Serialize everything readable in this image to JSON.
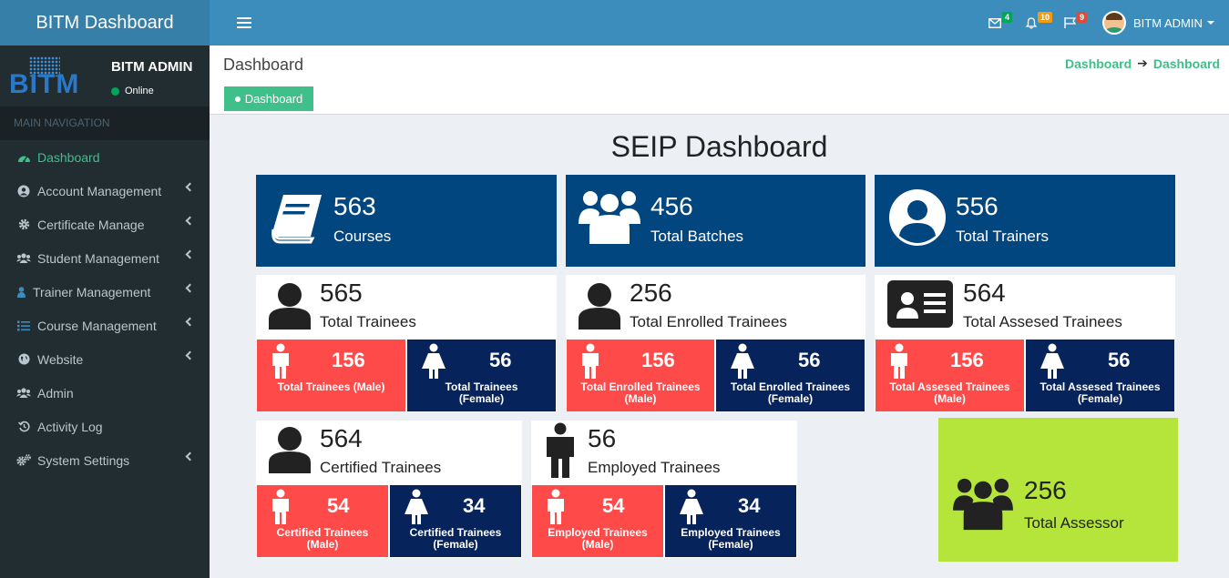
{
  "app": {
    "title": "BITM Dashboard"
  },
  "topbar": {
    "mail_badge": "4",
    "bell_badge": "10",
    "flag_badge": "9",
    "user_name": "BITM ADMIN",
    "colors": {
      "green": "#00a65a",
      "orange": "#f39c12",
      "red": "#dd4b39"
    }
  },
  "sidebar": {
    "logo_text": "BITM",
    "user_name": "BITM ADMIN",
    "status": "Online",
    "nav_header": "MAIN NAVIGATION",
    "items": [
      {
        "label": "Dashboard",
        "icon": "dashboard-icon"
      },
      {
        "label": "Account Management",
        "icon": "user-circle-icon"
      },
      {
        "label": "Certificate Manage",
        "icon": "gear-icon"
      },
      {
        "label": "Student Management",
        "icon": "users-icon"
      },
      {
        "label": "Trainer Management",
        "icon": "user-icon"
      },
      {
        "label": "Course Management",
        "icon": "list-icon"
      },
      {
        "label": "Website",
        "icon": "globe-icon"
      },
      {
        "label": "Admin",
        "icon": "users-icon"
      },
      {
        "label": "Activity Log",
        "icon": "history-icon"
      },
      {
        "label": "System Settings",
        "icon": "gears-icon"
      }
    ]
  },
  "content_header": {
    "title": "Dashboard",
    "breadcrumb_1": "Dashboard",
    "breadcrumb_2": "Dashboard",
    "button_label": "Dashboard"
  },
  "dashboard": {
    "title": "SEIP Dashboard",
    "courses": {
      "value": "563",
      "label": "Courses"
    },
    "batches": {
      "value": "456",
      "label": "Total Batches"
    },
    "trainers": {
      "value": "556",
      "label": "Total Trainers"
    },
    "total_trainees": {
      "value": "565",
      "label": "Total Trainees",
      "male_value": "156",
      "male_label_1": "Total Trainees (Male)",
      "male_label_2": "",
      "female_value": "56",
      "female_label_1": "Total Trainees",
      "female_label_2": "(Female)"
    },
    "enrolled": {
      "value": "256",
      "label": "Total Enrolled Trainees",
      "male_value": "156",
      "male_label_1": "Total Enrolled Trainees",
      "male_label_2": "(Male)",
      "female_value": "56",
      "female_label_1": "Total Enrolled Trainees",
      "female_label_2": "(Female)"
    },
    "assessed": {
      "value": "564",
      "label": "Total Assesed Trainees",
      "male_value": "156",
      "male_label_1": "Total Assesed Trainees",
      "male_label_2": "(Male)",
      "female_value": "56",
      "female_label_1": "Total Assesed Trainees",
      "female_label_2": "(Female)"
    },
    "certified": {
      "value": "564",
      "label": "Certified Trainees",
      "male_value": "54",
      "male_label_1": "Certified Trainees",
      "male_label_2": "(Male)",
      "female_value": "34",
      "female_label_1": "Certified Trainees",
      "female_label_2": "(Female)"
    },
    "employed": {
      "value": "56",
      "label": "Employed Trainees",
      "male_value": "54",
      "male_label_1": "Employed Trainees",
      "male_label_2": "(Male)",
      "female_value": "34",
      "female_label_1": "Employed Trainees",
      "female_label_2": "(Female)"
    },
    "assessor": {
      "value": "256",
      "label": "Total Assessor"
    },
    "colors": {
      "blue": "#02467f",
      "red": "#ff4a4a",
      "navy": "#06235b",
      "lime": "#b5e43a",
      "green": "#3fbf8a"
    }
  }
}
